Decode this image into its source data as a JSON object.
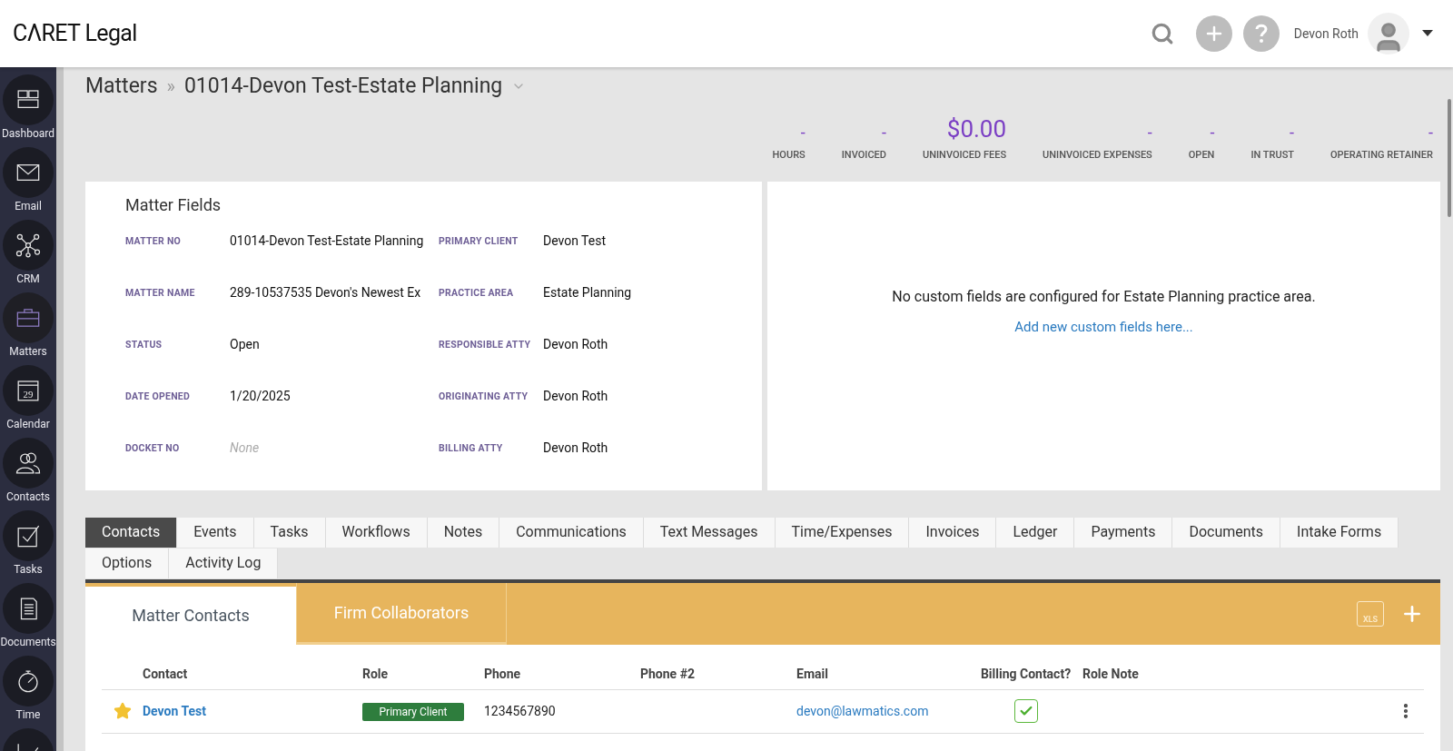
{
  "header": {
    "logo": "CΛRET Legal",
    "user_name": "Devon Roth"
  },
  "breadcrumb": {
    "root": "Matters",
    "separator": "»",
    "current": "01014-Devon Test-Estate Planning"
  },
  "sidebar": {
    "items": [
      {
        "label": "Dashboard",
        "kind": "dashboard",
        "selected": false
      },
      {
        "label": "Email",
        "kind": "email",
        "selected": false
      },
      {
        "label": "CRM",
        "kind": "crm",
        "selected": false
      },
      {
        "label": "Matters",
        "kind": "matters",
        "selected": true
      },
      {
        "label": "Calendar",
        "kind": "calendar",
        "icon_text": "29",
        "selected": false
      },
      {
        "label": "Contacts",
        "kind": "contacts",
        "selected": false
      },
      {
        "label": "Tasks",
        "kind": "tasks",
        "selected": false
      },
      {
        "label": "Documents",
        "kind": "documents",
        "selected": false
      },
      {
        "label": "Time",
        "kind": "time",
        "selected": false
      },
      {
        "kind": "reports",
        "selected": false
      }
    ]
  },
  "summary": [
    {
      "value": "-",
      "label": "HOURS",
      "kind": "dash"
    },
    {
      "value": "-",
      "label": "INVOICED",
      "kind": "dash"
    },
    {
      "value": "$0.00",
      "label": "UNINVOICED FEES",
      "kind": "amount"
    },
    {
      "value": "-",
      "label": "UNINVOICED EXPENSES",
      "kind": "dash"
    },
    {
      "value": "-",
      "label": "OPEN",
      "kind": "dash"
    },
    {
      "value": "-",
      "label": "IN TRUST",
      "kind": "dash"
    },
    {
      "value": "-",
      "label": "OPERATING RETAINER",
      "kind": "dash"
    }
  ],
  "matter_fields": {
    "title": "Matter Fields",
    "fields": [
      {
        "label": "MATTER NO",
        "value": "01014-Devon Test-Estate Planning",
        "empty": false
      },
      {
        "label": "PRIMARY CLIENT",
        "value": "Devon Test",
        "empty": false
      },
      {
        "label": "MATTER NAME",
        "value": "289-10537535 Devon's Newest Ex",
        "empty": false
      },
      {
        "label": "PRACTICE AREA",
        "value": "Estate Planning",
        "empty": false
      },
      {
        "label": "STATUS",
        "value": "Open",
        "empty": false
      },
      {
        "label": "RESPONSIBLE ATTY",
        "value": "Devon Roth",
        "empty": false
      },
      {
        "label": "DATE OPENED",
        "value": "1/20/2025",
        "empty": false
      },
      {
        "label": "ORIGINATING ATTY",
        "value": "Devon Roth",
        "empty": false
      },
      {
        "label": "DOCKET NO",
        "value": "None",
        "empty": true
      },
      {
        "label": "BILLING ATTY",
        "value": "Devon Roth",
        "empty": false
      }
    ]
  },
  "custom_fields": {
    "message": "No custom fields are configured for Estate Planning practice area.",
    "link": "Add new custom fields here..."
  },
  "tabs": [
    {
      "label": "Contacts",
      "selected": true
    },
    {
      "label": "Events",
      "selected": false
    },
    {
      "label": "Tasks",
      "selected": false
    },
    {
      "label": "Workflows",
      "selected": false
    },
    {
      "label": "Notes",
      "selected": false
    },
    {
      "label": "Communications",
      "selected": false
    },
    {
      "label": "Text Messages",
      "selected": false
    },
    {
      "label": "Time/Expenses",
      "selected": false
    },
    {
      "label": "Invoices",
      "selected": false
    },
    {
      "label": "Ledger",
      "selected": false
    },
    {
      "label": "Payments",
      "selected": false
    },
    {
      "label": "Documents",
      "selected": false
    },
    {
      "label": "Intake Forms",
      "selected": false
    },
    {
      "label": "Options",
      "selected": false
    },
    {
      "label": "Activity Log",
      "selected": false
    }
  ],
  "subtabs": [
    {
      "label": "Matter Contacts",
      "selected": true
    },
    {
      "label": "Firm Collaborators",
      "selected": false
    }
  ],
  "export_label": "XLS",
  "table": {
    "columns": [
      "Contact",
      "Role",
      "Phone",
      "Phone #2",
      "Email",
      "Billing Contact?",
      "Role Note"
    ],
    "rows": [
      {
        "starred": true,
        "contact": "Devon Test",
        "role": "Primary Client",
        "phone": "1234567890",
        "email": "devon@lawmatics.com",
        "billing_contact": true
      }
    ]
  }
}
